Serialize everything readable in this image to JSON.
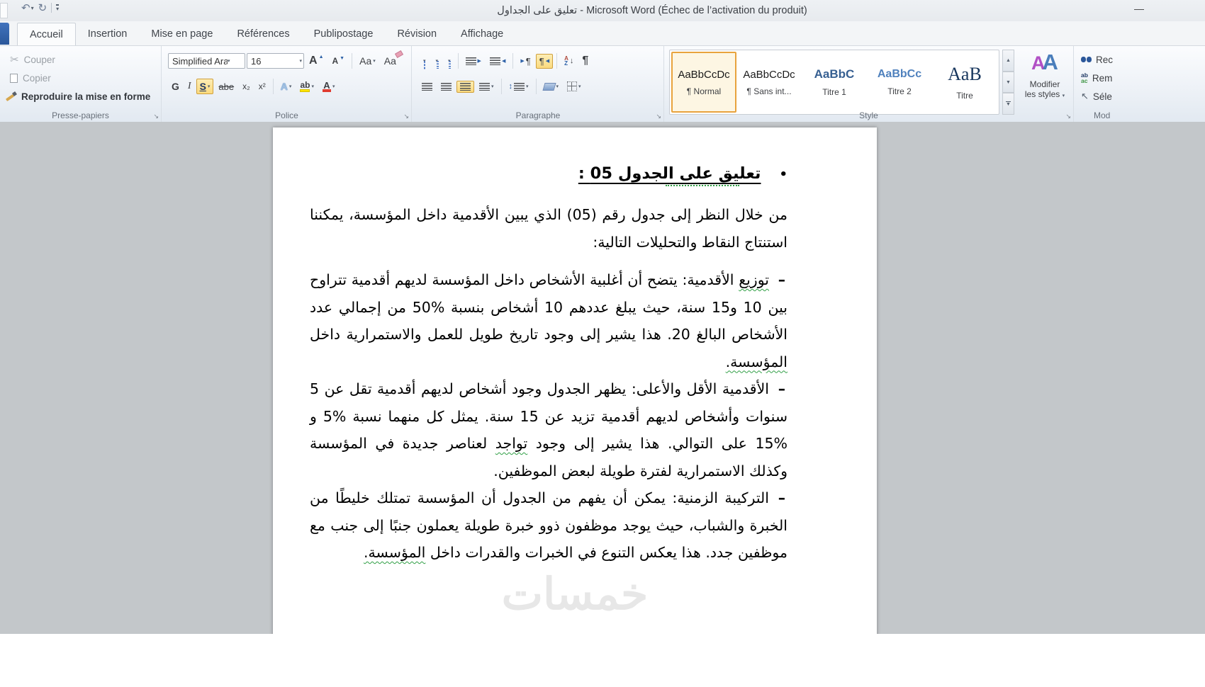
{
  "title_bar": {
    "title": "تعليق على الجداول - Microsoft Word (Échec de l’activation du produit)",
    "minimize": "—"
  },
  "quick_access": {
    "undo": "↶",
    "redo": "↻",
    "caret": "▾"
  },
  "tabs": [
    "Accueil",
    "Insertion",
    "Mise en page",
    "Références",
    "Publipostage",
    "Révision",
    "Affichage"
  ],
  "ribbon": {
    "launcher": "↘",
    "clipboard": {
      "label": "Presse-papiers",
      "cut": "Couper",
      "copy": "Copier",
      "painter": "Reproduire la mise en forme",
      "cut_icon": "✂"
    },
    "font": {
      "label": "Police",
      "name": "Simplified Ara",
      "size": "16",
      "bold": "G",
      "italic": "I",
      "underline": "S",
      "strike": "abe",
      "subscript": "x₂",
      "superscript": "x²",
      "grow": "A",
      "shrink": "A",
      "tri_up": "▲",
      "tri_down": "▼",
      "case": "Aa",
      "clear": "Aa",
      "effects": "A",
      "highlight": "ab",
      "color": "A"
    },
    "paragraph": {
      "label": "Paragraphe",
      "pilcrow": "¶",
      "tri_left": "◀",
      "tri_right": "▶",
      "sort_a": "A",
      "sort_z": "Z",
      "arrow_down": "↓",
      "updown": "↕"
    },
    "styles": {
      "label": "Style",
      "modify": "Modifier",
      "modify2": "les styles",
      "aa_left": "A",
      "aa_right": "A",
      "up": "▲",
      "down": "▼",
      "gallery": [
        {
          "preview": "AaBbCcDc",
          "name": "¶ Normal"
        },
        {
          "preview": "AaBbCcDc",
          "name": "¶ Sans int..."
        },
        {
          "preview": "AaBbC",
          "name": "Titre 1"
        },
        {
          "preview": "AaBbCc",
          "name": "Titre 2"
        },
        {
          "preview": "AaB",
          "name": "Titre"
        }
      ]
    },
    "editing": {
      "label": "Mod",
      "find": "Rec",
      "replace": "Rem",
      "select": "Séle",
      "replace_top": "ab",
      "replace_bottom": "ac",
      "select_icon": "↖"
    }
  },
  "document": {
    "heading_bullet": "•",
    "heading": "تعليق على الجدول 05 :",
    "intro": "من خلال النظر إلى جدول رقم (05) الذي يبين الأقدمية داخل المؤسسة، يمكننا استنتاج النقاط والتحليلات التالية:",
    "bullets": [
      {
        "marker": "–",
        "seg0": "توزيع",
        "seg1": " الأقدمية: يتضح أن أغلبية الأشخاص داخل المؤسسة لديهم أقدمية تتراوح بين 10 و15 سنة، حيث يبلغ عددهم 10 أشخاص بنسبة %50 من إجمالي عدد الأشخاص البالغ 20. هذا يشير إلى وجود تاريخ طويل للعمل والاستمرارية داخل ",
        "seg2": "المؤسسة."
      },
      {
        "marker": "–",
        "seg0": "الأقدمية الأقل والأعلى: يظهر الجدول وجود أشخاص لديهم أقدمية تقل عن 5 سنوات وأشخاص لديهم أقدمية تزيد عن 15 سنة. يمثل كل منهما نسبة %5 و %15 على التوالي. هذا يشير إلى وجود ",
        "seg1": "تواجد",
        "seg2": " لعناصر جديدة في المؤسسة وكذلك الاستمرارية لفترة طويلة لبعض الموظفين."
      },
      {
        "marker": "–",
        "seg0": "",
        "seg1": "التركيبة الزمنية: يمكن أن يفهم من الجدول أن المؤسسة تمتلك خليطًا من الخبرة والشباب، حيث يوجد موظفون ذوو خبرة طويلة يعملون جنبًا إلى جنب مع موظفين جدد. هذا يعكس التنوع في الخبرات والقدرات داخل ",
        "seg2": "المؤسسة."
      }
    ],
    "watermark": "خمسات"
  }
}
